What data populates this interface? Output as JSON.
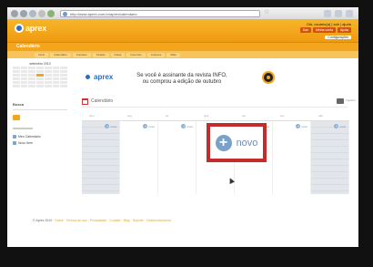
{
  "browser": {
    "url": "http://www.aprex.com.br/aprex/calendario"
  },
  "app": {
    "logo_text": "aprex",
    "user_text": "Olá, usuário(a) | sair | ajuda",
    "header_buttons": [
      "Sair",
      "Minha conta",
      "Ajuda"
    ],
    "settings_link": "Configurações",
    "section_title": "Calendário",
    "tabs": [
      "Início",
      "Calendário",
      "Contatos",
      "Tarefas",
      "Notas",
      "Favoritos",
      "Arquivos",
      "Mais"
    ]
  },
  "sidebar": {
    "mini_calendar_title": "setembro 2010",
    "box_label": "Busca",
    "items": [
      "Meu Calendário",
      "Novo Item"
    ]
  },
  "banner": {
    "logo_text": "aprex",
    "text_line1": "Se você é assinante da revista INFO,",
    "text_line2": "ou comprou a edição de outubro"
  },
  "calendar": {
    "heading": "Calendário",
    "print_label": "Imprimir",
    "days": [
      "dom",
      "seg",
      "ter",
      "qua",
      "qui",
      "sex",
      "sáb"
    ],
    "new_chip_label": "novo",
    "new_button_label": "novo"
  },
  "footer": {
    "text": "© Aprex 2010 ·",
    "links": "Sobre · Termos de uso · Privacidade · Contato · Blog · Suporte · Desenvolvedores"
  }
}
